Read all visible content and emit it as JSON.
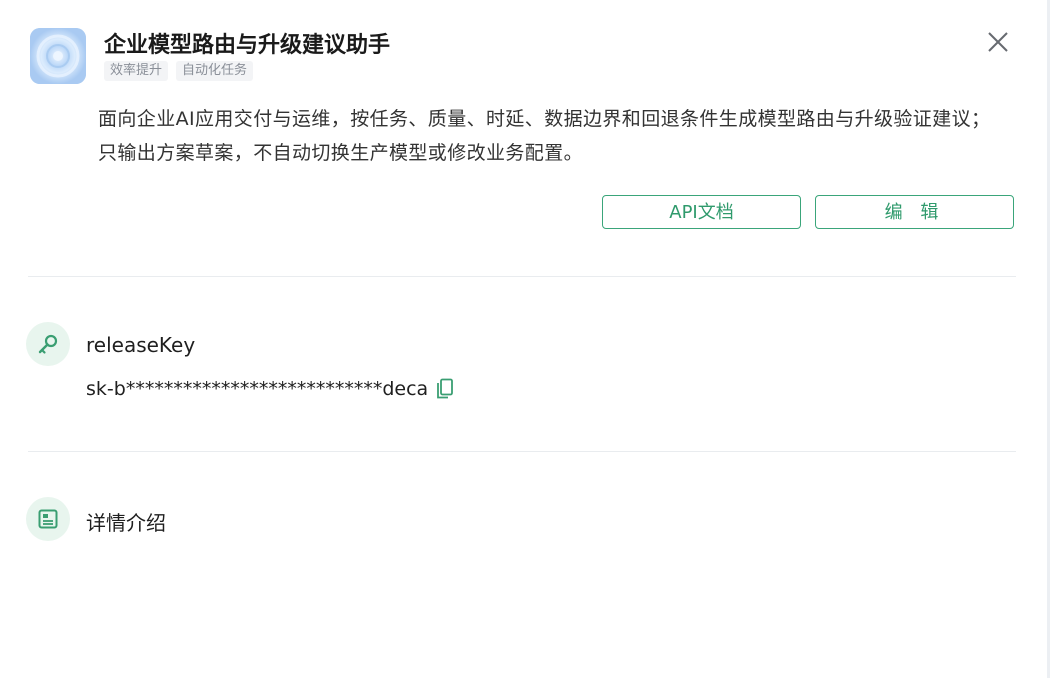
{
  "header": {
    "title": "企业模型路由与升级建议助手",
    "tags": [
      "效率提升",
      "自动化任务"
    ],
    "icon": "app-avatar-icon"
  },
  "description": "面向企业AI应用交付与运维，按任务、质量、时延、数据边界和回退条件生成模型路由与升级验证建议；只输出方案草案，不自动切换生产模型或修改业务配置。",
  "actions": {
    "api_docs_label": "API文档",
    "edit_label": "编 辑"
  },
  "release_key": {
    "title": "releaseKey",
    "value": "sk-b***************************deca",
    "icon": "key-icon"
  },
  "details": {
    "title": "详情介绍",
    "icon": "document-icon"
  },
  "colors": {
    "accent": "#3aa57a",
    "icon_bg": "#e8f5ee"
  }
}
